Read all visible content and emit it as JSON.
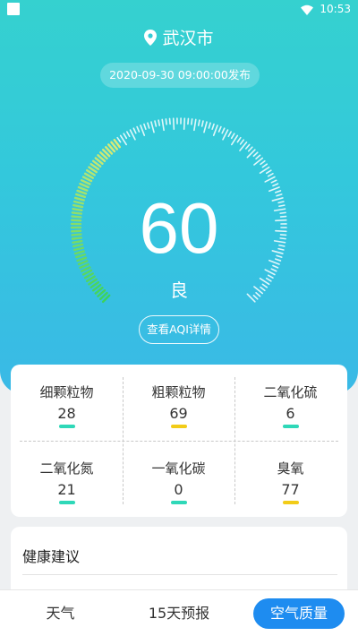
{
  "status": {
    "time": "10:53"
  },
  "location": {
    "city": "武汉市"
  },
  "publish": {
    "text": "2020-09-30 09:00:00发布"
  },
  "aqi": {
    "value": "60",
    "level": "良",
    "detail_button": "查看AQI详情",
    "fraction": 0.2
  },
  "pollutants": [
    {
      "name": "细颗粒物",
      "value": "28",
      "indicator_color": "#2fd8b8"
    },
    {
      "name": "粗颗粒物",
      "value": "69",
      "indicator_color": "#f2cc18"
    },
    {
      "name": "二氧化硫",
      "value": "6",
      "indicator_color": "#2fd8b8"
    },
    {
      "name": "二氧化氮",
      "value": "21",
      "indicator_color": "#2fd8b8"
    },
    {
      "name": "一氧化碳",
      "value": "0",
      "indicator_color": "#2fd8b8"
    },
    {
      "name": "臭氧",
      "value": "77",
      "indicator_color": "#f2cc18"
    }
  ],
  "advice": {
    "title": "健康建议"
  },
  "tabs": [
    {
      "label": "天气",
      "active": false
    },
    {
      "label": "15天预报",
      "active": false
    },
    {
      "label": "空气质量",
      "active": true
    }
  ],
  "colors": {
    "hero_start": "#35d1cf",
    "hero_end": "#3ab9e6",
    "active_tab": "#1e8cf0"
  }
}
